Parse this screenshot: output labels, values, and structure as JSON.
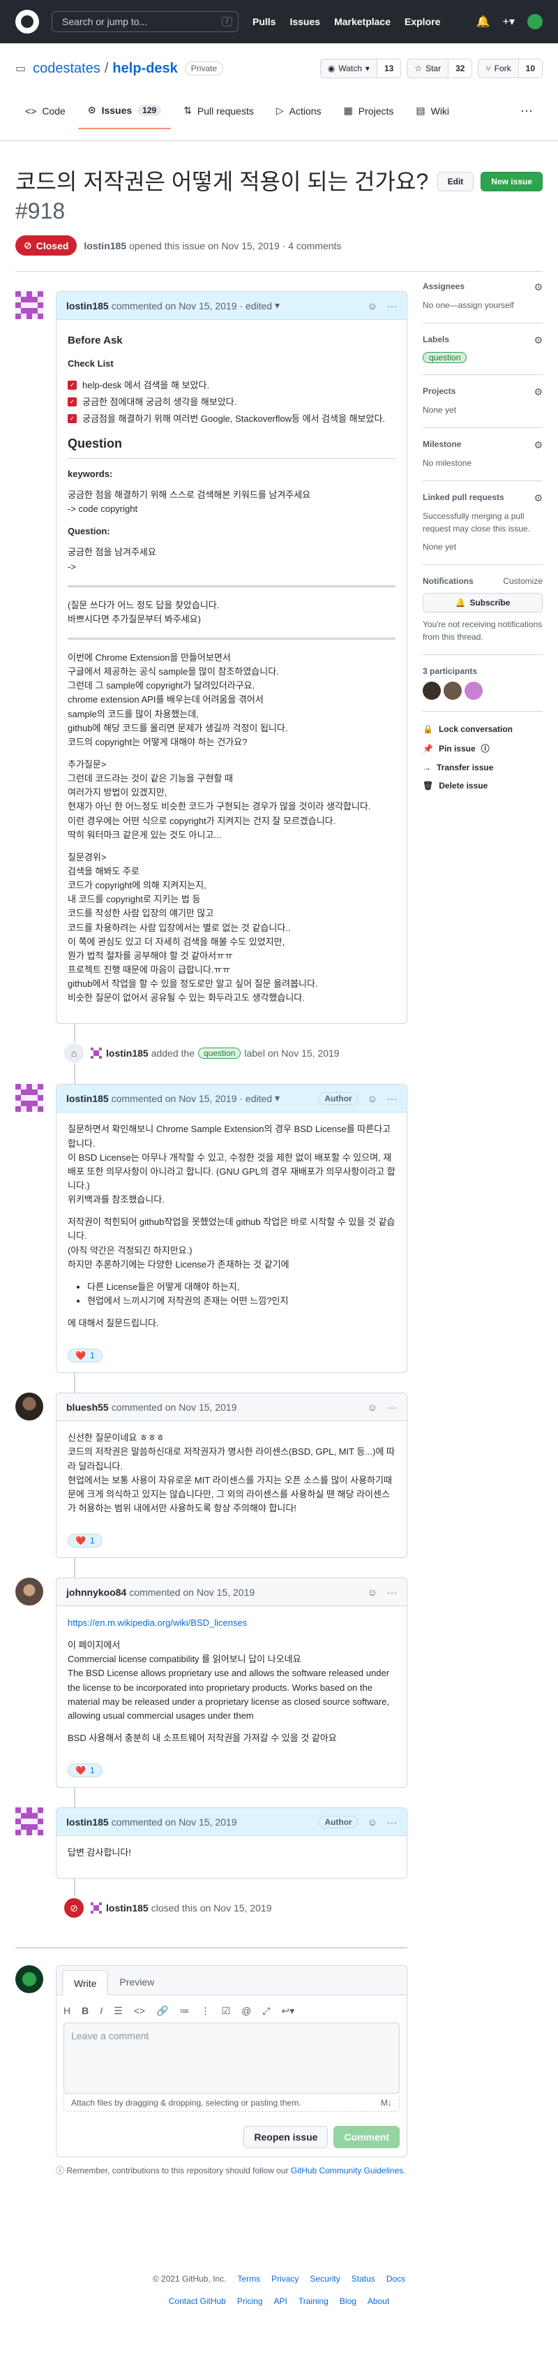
{
  "header": {
    "search_placeholder": "Search or jump to...",
    "slash": "/",
    "nav": [
      "Pulls",
      "Issues",
      "Marketplace",
      "Explore"
    ]
  },
  "repo": {
    "owner": "codestates",
    "name": "help-desk",
    "visibility": "Private",
    "watch": "Watch",
    "watch_count": "13",
    "star": "Star",
    "star_count": "32",
    "fork": "Fork",
    "fork_count": "10"
  },
  "tabs": [
    {
      "label": "Code"
    },
    {
      "label": "Issues",
      "count": "129"
    },
    {
      "label": "Pull requests"
    },
    {
      "label": "Actions"
    },
    {
      "label": "Projects"
    },
    {
      "label": "Wiki"
    }
  ],
  "issue": {
    "title": "코드의 저작권은 어떻게 적용이 되는 건가요?",
    "number": "#918",
    "edit": "Edit",
    "new_issue": "New issue",
    "state": "Closed",
    "author": "lostin185",
    "meta": "opened this issue on Nov 15, 2019 · 4 comments"
  },
  "c1": {
    "author": "lostin185",
    "meta": "commented on Nov 15, 2019 · edited",
    "ask": "Before Ask",
    "checklist_title": "Check List",
    "checks": [
      "help-desk 에서 검색을 해 보았다.",
      "궁금한 점에대해 궁금히 생각을 해보았다.",
      "궁금점을 해결하기 위해 여러번 Google, Stackoverflow등 에서 검색을 해보았다."
    ],
    "question_h": "Question",
    "keywords_h": "keywords:",
    "kw1": "궁금한 점을 해결하기 위해 스스로 검색해본 키워드를 남겨주세요",
    "kw2": "-> code copyright",
    "q_h": "Question:",
    "q1": "궁금한 점을 남겨주세요",
    "q2": "->",
    "p1a": "(질문 쓰다가 어느 정도 답을 찾았습니다.",
    "p1b": "바쁘시다면 추가질문부터 봐주세요)",
    "body": [
      "이번에 Chrome Extension을 만들어보면서",
      "구글에서 제공하는 공식 sample을 많이 참조하였습니다.",
      "그런데 그 sample에 copyright가 달려있더라구요.",
      "chrome extension API를 배우는데 어려움을 겪어서",
      "sample의 코드를 많이 차용했는데,",
      "github에 해당 코드를 올리면 문제가 생길까 걱정이 됩니다.",
      "코드의 copyright는 어떻게 대해야 하는 건가요?"
    ],
    "extra": [
      "추가질문>",
      "그런데 코드라는 것이 같은 기능을 구현할 때",
      "여러가지 방법이 있겠지만,",
      "현재가 아닌 한 어느정도 비슷한 코드가 구현되는 경우가 많을 것이라 생각합니다.",
      "이런 경우에는 어떤 식으로 copyright가 지켜지는 건지 잘 모르겠습니다.",
      "딱히 워터마크 같은게 있는 것도 아니고..."
    ],
    "why": [
      "질문경위>",
      "검색을 해봐도 주로",
      "코드가 copyright에 의해 지켜지는지,",
      "내 코드를 copyright로 지키는 법 등",
      "코드를 작성한 사람 입장의 얘기만 많고",
      "코드를 차용하려는 사람 입장에서는 별로 없는 것 같습니다..",
      "이 쪽에 관심도 있고 더 자세히 검색을 해볼 수도 있었지만,",
      "뭔가 법적 절차를 공부해야 할 것 같아서ㅠㅠ",
      "프로젝트 진행 때문에 마음이 급합니다.ㅠㅠ",
      "github에서 작업을 할 수 있을 정도로만 알고 싶어 질문 올려봅니다.",
      "비슷한 질문이 없어서 공유될 수 있는 화두라고도 생각했습니다."
    ]
  },
  "ev1": {
    "author": "lostin185",
    "pre": "added the",
    "label": "question",
    "post": "label on Nov 15, 2019"
  },
  "c2": {
    "author": "lostin185",
    "meta": "commented on Nov 15, 2019 · edited",
    "tag": "Author",
    "p1": [
      "질문하면서 확인해보니 Chrome Sample Extension의 경우 BSD License를 따른다고 합니다.",
      "이 BSD License는 아무나 개작할 수 있고, 수정한 것을 제한 없이 배포할 수 있으며, 재배포 또한 의무사항이 아니라고 합니다. (GNU GPL의 경우 재배포가 의무사항이라고 합니다.)",
      "위키백과를 참조했습니다."
    ],
    "p2": [
      "저작권이 적힌되어 github작업을 못했었는데 github 작업은 바로 시작할 수 있을 것 같습니다.",
      "(아직 약간은 걱정되긴 하지만요.)",
      "하지만 추론하기에는 다양한 License가 존재하는 것 같기에"
    ],
    "list": [
      "다른 License들은 어떻게 대해야 하는지,",
      "현업에서 느끼시기에 저작권의 존재는 어떤 느낌?인지"
    ],
    "p3": "에 대해서 질문드립니다.",
    "reaction": "1"
  },
  "c3": {
    "author": "bluesh55",
    "meta": "commented on Nov 15, 2019",
    "p1": "신선한 질문이네요 ㅎㅎㅎ",
    "p2": "코드의 저작권은 말씀하신대로 저작권자가 명시한 라이센스(BSD, GPL, MIT 등...)에 따라 달라집니다.",
    "p3": "현업에서는 보통 사용이 자유로운 MIT 라이센스를 가지는 오픈 소스를 많이 사용하기때문에 크게 의식하고 있지는 않습니다만, 그 외의 라이센스를 사용하실 땐 해당 라이센스가 허용하는 범위 내에서만 사용하도록 항상 주의해야 합니다!",
    "reaction": "1"
  },
  "c4": {
    "author": "johnnykoo84",
    "meta": "commented on Nov 15, 2019",
    "link": "https://en.m.wikipedia.org/wiki/BSD_licenses",
    "p1": "이 페이지에서",
    "p2": "Commercial license compatibility 를 읽어보니 답이 나오네요",
    "p3": "The BSD License allows proprietary use and allows the software released under the license to be incorporated into proprietary products. Works based on the material may be released under a proprietary license as closed source software, allowing usual commercial usages under them",
    "p4": "BSD 사용해서 충분히 내 소프트웨어 저작권을 가져갈 수 있을 것 같아요",
    "reaction": "1"
  },
  "c5": {
    "author": "lostin185",
    "meta": "commented on Nov 15, 2019",
    "tag": "Author",
    "p1": "답변 감사합니다!"
  },
  "ev2": {
    "author": "lostin185",
    "text": "closed this on Nov 15, 2019"
  },
  "new_comment": {
    "write": "Write",
    "preview": "Preview",
    "placeholder": "Leave a comment",
    "attach": "Attach files by dragging & dropping, selecting or pasting them.",
    "reopen": "Reopen issue",
    "comment": "Comment",
    "note_pre": "Remember, contributions to this repository should follow our ",
    "note_link": "GitHub Community Guidelines",
    "note_post": "."
  },
  "sidebar": {
    "assignees": "Assignees",
    "assignees_v": "No one—assign yourself",
    "labels": "Labels",
    "label_v": "question",
    "projects": "Projects",
    "projects_v": "None yet",
    "milestone": "Milestone",
    "milestone_v": "No milestone",
    "linked": "Linked pull requests",
    "linked_v": "Successfully merging a pull request may close this issue.",
    "linked_v2": "None yet",
    "notif": "Notifications",
    "customize": "Customize",
    "subscribe": "Subscribe",
    "notif_v": "You're not receiving notifications from this thread.",
    "participants": "3 participants",
    "lock": "Lock conversation",
    "pin": "Pin issue",
    "transfer": "Transfer issue",
    "delete": "Delete issue"
  },
  "footer": {
    "copy": "© 2021 GitHub, Inc.",
    "row1": [
      "Terms",
      "Privacy",
      "Security",
      "Status",
      "Docs"
    ],
    "row2": [
      "Contact GitHub",
      "Pricing",
      "API",
      "Training",
      "Blog",
      "About"
    ]
  }
}
